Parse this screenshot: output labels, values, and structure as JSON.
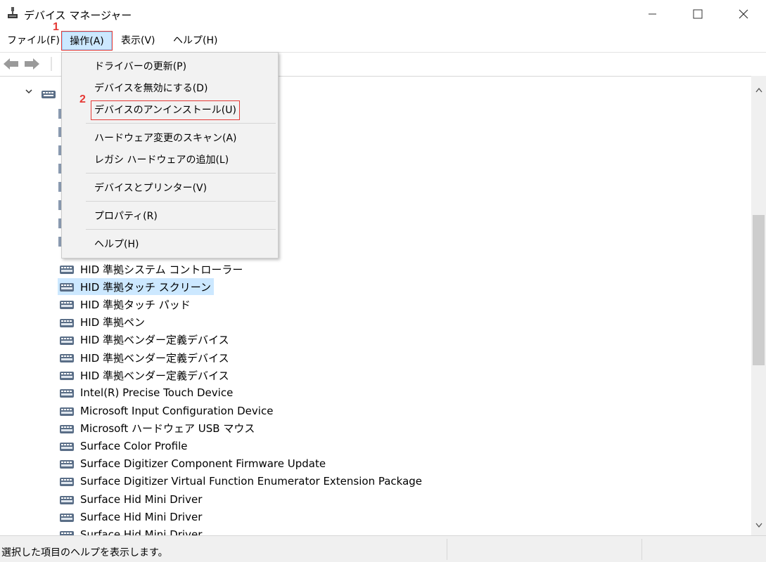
{
  "window": {
    "title": "デバイス マネージャー",
    "controls": [
      "minimize",
      "maximize",
      "close"
    ]
  },
  "menubar": {
    "items": [
      {
        "label": "ファイル(F)"
      },
      {
        "label": "操作(A)"
      },
      {
        "label": "表示(V)"
      },
      {
        "label": "ヘルプ(H)"
      }
    ]
  },
  "annotations": {
    "step1": "1",
    "step2": "2"
  },
  "dropdown": {
    "items": [
      {
        "label": "ドライバーの更新(P)"
      },
      {
        "label": "デバイスを無効にする(D)"
      },
      {
        "label": "デバイスのアンインストール(U)"
      },
      {
        "label": "ハードウェア変更のスキャン(A)"
      },
      {
        "label": "レガシ ハードウェアの追加(L)"
      },
      {
        "label": "デバイスとプリンター(V)"
      },
      {
        "label": "プロパティ(R)"
      },
      {
        "label": "ヘルプ(H)"
      }
    ]
  },
  "tree": {
    "devices": [
      {
        "label": "HID 準拠システム コントローラー"
      },
      {
        "label": "HID 準拠タッチ スクリーン"
      },
      {
        "label": "HID 準拠タッチ パッド"
      },
      {
        "label": "HID 準拠ペン"
      },
      {
        "label": "HID 準拠ベンダー定義デバイス"
      },
      {
        "label": "HID 準拠ベンダー定義デバイス"
      },
      {
        "label": "HID 準拠ベンダー定義デバイス"
      },
      {
        "label": "Intel(R) Precise Touch Device"
      },
      {
        "label": "Microsoft Input Configuration Device"
      },
      {
        "label": "Microsoft ハードウェア USB マウス"
      },
      {
        "label": "Surface Color Profile"
      },
      {
        "label": "Surface Digitizer Component Firmware Update"
      },
      {
        "label": "Surface Digitizer Virtual Function Enumerator Extension Package"
      },
      {
        "label": "Surface Hid Mini Driver"
      },
      {
        "label": "Surface Hid Mini Driver"
      },
      {
        "label": "Surface Hid Mini Driver"
      }
    ]
  },
  "statusbar": {
    "text": "選択した項目のヘルプを表示します。"
  },
  "colors": {
    "selection": "#cce8ff",
    "annotation_red": "#e53935",
    "menu_bg": "#f2f2f2"
  }
}
